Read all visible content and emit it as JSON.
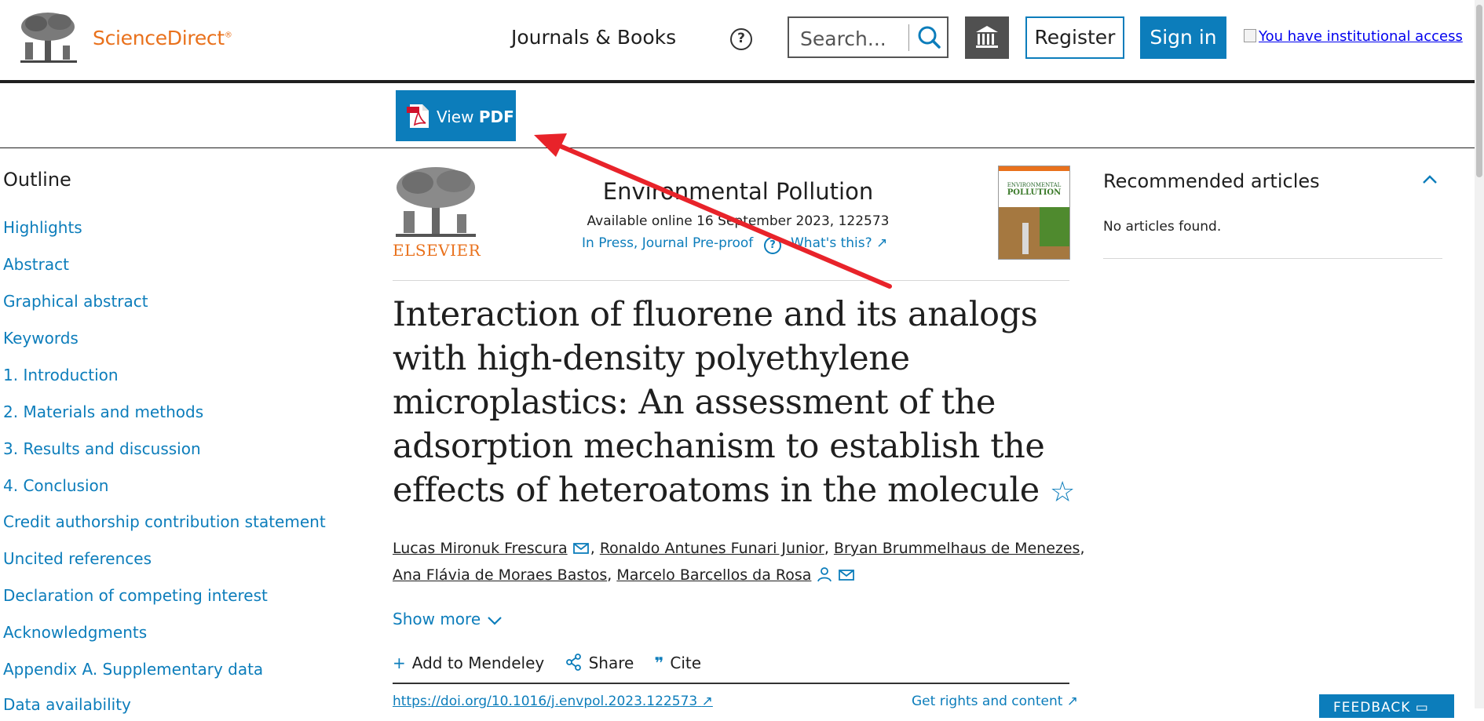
{
  "header": {
    "brand": "ScienceDirect",
    "brand_mark": "®",
    "nav_journals": "Journals & Books",
    "help_glyph": "?",
    "search_placeholder": "Search...",
    "register": "Register",
    "sign_in": "Sign in",
    "institutional_access": "You have institutional access"
  },
  "toolbar": {
    "view": "View ",
    "pdf": "PDF"
  },
  "outline": {
    "title": "Outline",
    "items": [
      "Highlights",
      "Abstract",
      "Graphical abstract",
      "Keywords",
      "1. Introduction",
      "2. Materials and methods",
      "3. Results and discussion",
      "4. Conclusion",
      "Credit authorship contribution statement",
      "Uncited references",
      "Declaration of competing interest",
      "Acknowledgments",
      "Appendix A. Supplementary data",
      "Data availability"
    ]
  },
  "article": {
    "publisher": "ELSEVIER",
    "journal": "Environmental Pollution",
    "available": "Available online 16 September 2023, 122573",
    "in_press": "In Press, Journal Pre-proof",
    "whats_this": "What's this?",
    "cover_title_1": "ENVIRONMENTAL",
    "cover_title_2": "POLLUTION",
    "title": "Interaction of fluorene and its analogs with high-density polyethylene microplastics: An assessment of the adsorption mechanism to establish the effects of heteroatoms in the molecule",
    "authors": [
      "Lucas Mironuk Frescura",
      "Ronaldo Antunes Funari Junior",
      "Bryan Brummelhaus de Menezes",
      "Ana Flávia de Moraes Bastos",
      "Marcelo Barcellos da Rosa"
    ],
    "show_more": "Show more",
    "actions": {
      "mendeley": "Add to Mendeley",
      "share": "Share",
      "cite": "Cite"
    },
    "doi": "https://doi.org/10.1016/j.envpol.2023.122573",
    "rights": "Get rights and content"
  },
  "recommended": {
    "title": "Recommended articles",
    "empty": "No articles found."
  },
  "feedback": "FEEDBACK",
  "colors": {
    "brand_orange": "#e9711c",
    "link_blue": "#0c7dbb",
    "annotation_red": "#e8232a"
  }
}
